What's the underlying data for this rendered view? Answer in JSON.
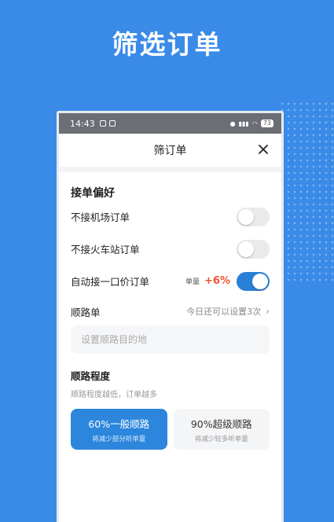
{
  "headline": "筛选订单",
  "statusbar": {
    "time": "14:43",
    "battery": "73"
  },
  "dialog": {
    "title": "筛订单"
  },
  "preferences": {
    "section_title": "接单偏好",
    "items": [
      {
        "label": "不接机场订单",
        "on": false
      },
      {
        "label": "不接火车站订单",
        "on": false
      },
      {
        "label": "自动接一口价订单",
        "on": true,
        "unit_label": "单量",
        "bonus": "+6%"
      }
    ]
  },
  "route": {
    "title": "顺路单",
    "hint": "今日还可以设置3次",
    "placeholder": "设置顺路目的地"
  },
  "degree": {
    "title": "顺路程度",
    "subtitle": "顺路程度越低，订单越多",
    "options": [
      {
        "title": "60%一般顺路",
        "subtitle": "将减少部分听单量",
        "selected": true
      },
      {
        "title": "90%超级顺路",
        "subtitle": "将减少较多听单量",
        "selected": false
      }
    ]
  },
  "colors": {
    "accent": "#2b86dc",
    "background": "#3a8be8",
    "bonus": "#f0522e"
  }
}
